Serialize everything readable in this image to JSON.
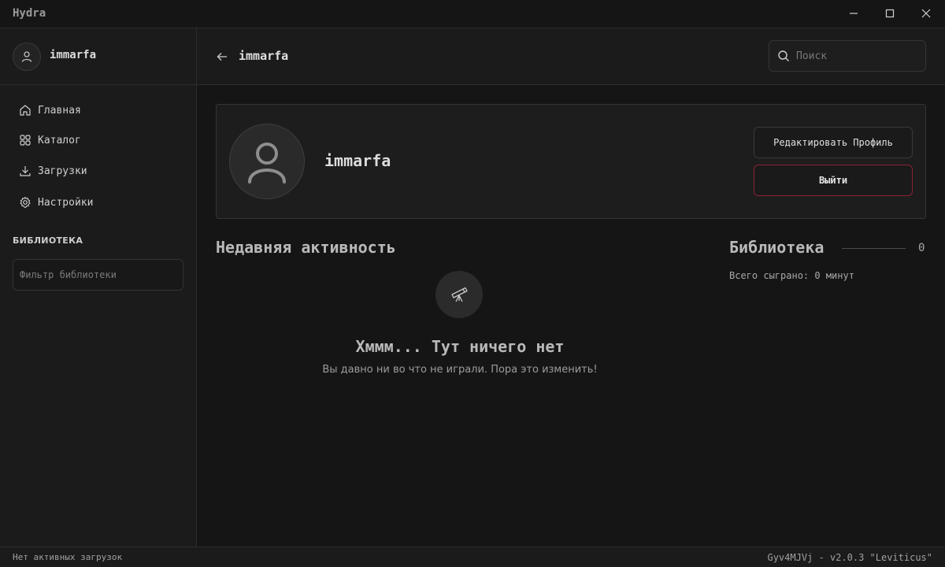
{
  "window": {
    "title": "Hydra",
    "controls": [
      "minimize-icon",
      "maximize-icon",
      "close-icon"
    ]
  },
  "sidebar": {
    "username": "immarfa",
    "avatar_icon": "user-icon",
    "items": [
      {
        "label": "Главная",
        "icon": "home-icon"
      },
      {
        "label": "Каталог",
        "icon": "grid-icon"
      },
      {
        "label": "Загрузки",
        "icon": "download-icon"
      },
      {
        "label": "Настройки",
        "icon": "gear-icon"
      }
    ],
    "library_heading": "БИБЛИОТЕКА",
    "library_filter_placeholder": "Фильтр библиотеки"
  },
  "header": {
    "title": "immarfa",
    "back_icon": "arrow-left-icon",
    "search_placeholder": "Поиск"
  },
  "profile": {
    "username": "immarfa",
    "edit_button": "Редактировать Профиль",
    "logout_button": "Выйти"
  },
  "recent": {
    "title": "Недавняя активность",
    "empty_icon": "telescope-icon",
    "empty_title": "Хммм... Тут ничего нет",
    "empty_subtitle": "Вы давно ни во что не играли. Пора это изменить!"
  },
  "library": {
    "title": "Библиотека",
    "count": "0",
    "total_played": "Всего сыграно: 0 минут"
  },
  "status": {
    "downloads": "Нет активных загрузок",
    "version": "Gyv4MJVj - v2.0.3 \"Leviticus\""
  },
  "colors": {
    "background": "#151515",
    "panel": "#1b1b1b",
    "border": "#2c2c2c",
    "logout_border": "#8c2236"
  }
}
